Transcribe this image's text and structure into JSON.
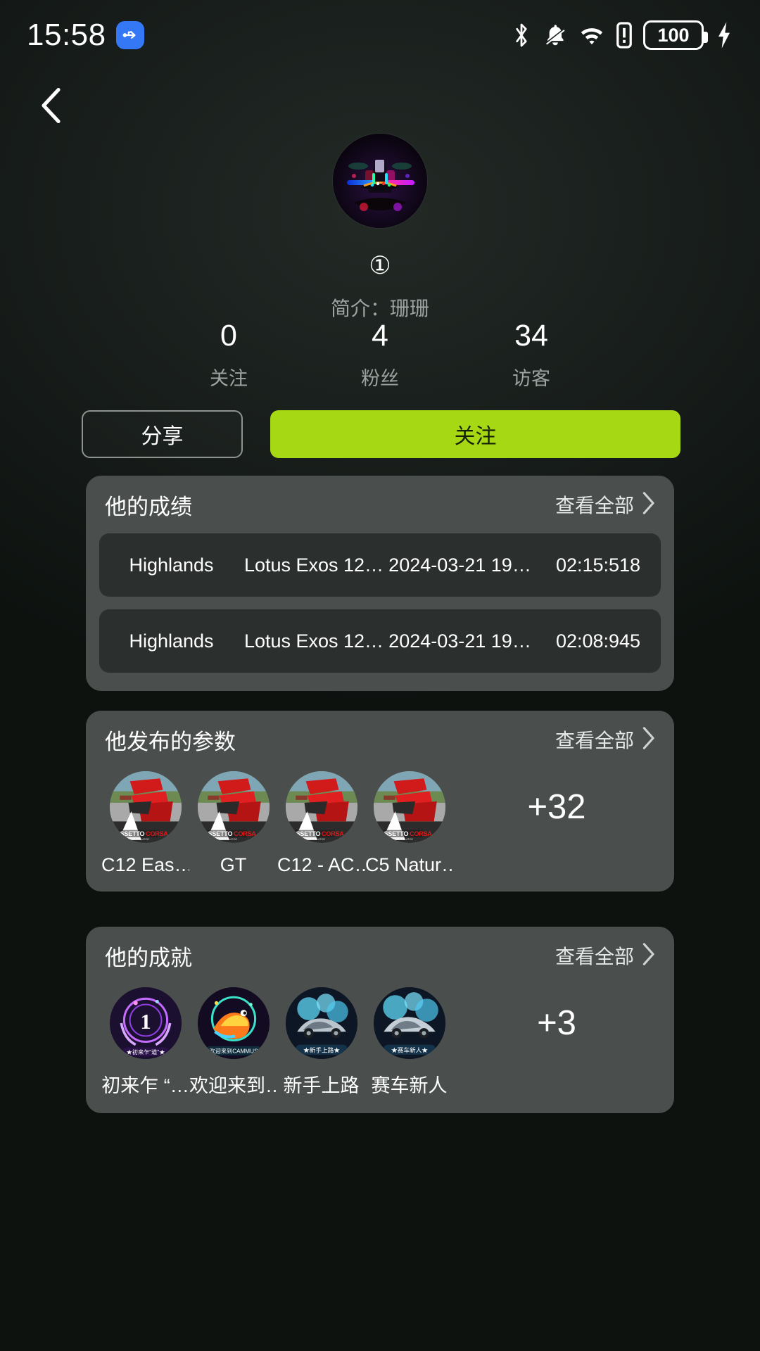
{
  "status_bar": {
    "time": "15:58",
    "usb_icon": "usb-icon",
    "bluetooth_icon": "bluetooth-icon",
    "silent_icon": "bell-muted-icon",
    "wifi_icon": "wifi-icon",
    "sim_icon": "sim-alert-icon",
    "battery_level": "100",
    "charging_icon": "charging-bolt-icon"
  },
  "nav": {
    "back_icon": "back-chevron-icon"
  },
  "profile": {
    "avatar_alt": "neon-racing-cockpit-avatar",
    "nickname": "①",
    "bio": "简介：珊珊"
  },
  "stats": [
    {
      "value": "0",
      "label": "关注"
    },
    {
      "value": "4",
      "label": "粉丝"
    },
    {
      "value": "34",
      "label": "访客"
    }
  ],
  "actions": {
    "share_label": "分享",
    "follow_label": "关注",
    "follow_color": "#a6d813"
  },
  "results_card": {
    "title": "他的成绩",
    "more_label": "查看全部",
    "more_icon": "chevron-right-icon",
    "rows": [
      {
        "track": "Highlands",
        "car": "Lotus Exos 12…",
        "date": "2024-03-21 19…",
        "time": "02:15:518"
      },
      {
        "track": "Highlands",
        "car": "Lotus Exos 12…",
        "date": "2024-03-21 19…",
        "time": "02:08:945"
      }
    ]
  },
  "setups_card": {
    "title": "他发布的参数",
    "more_label": "查看全部",
    "more_icon": "chevron-right-icon",
    "items": [
      {
        "label": "C12 Eas…",
        "thumb": "assetto-corsa-cover"
      },
      {
        "label": "GT",
        "thumb": "assetto-corsa-cover"
      },
      {
        "label": "C12 - AC…",
        "thumb": "assetto-corsa-cover"
      },
      {
        "label": "C5 Natur…",
        "thumb": "assetto-corsa-cover"
      }
    ],
    "more_count": "+32"
  },
  "achievements_card": {
    "title": "他的成就",
    "more_label": "查看全部",
    "more_icon": "chevron-right-icon",
    "items": [
      {
        "label": "初来乍 “…",
        "badge": "first-visit-badge"
      },
      {
        "label": "欢迎来到…",
        "badge": "welcome-cammus-badge"
      },
      {
        "label": "新手上路",
        "badge": "novice-driver-badge"
      },
      {
        "label": "赛车新人",
        "badge": "racing-rookie-badge"
      }
    ],
    "more_count": "+3"
  }
}
